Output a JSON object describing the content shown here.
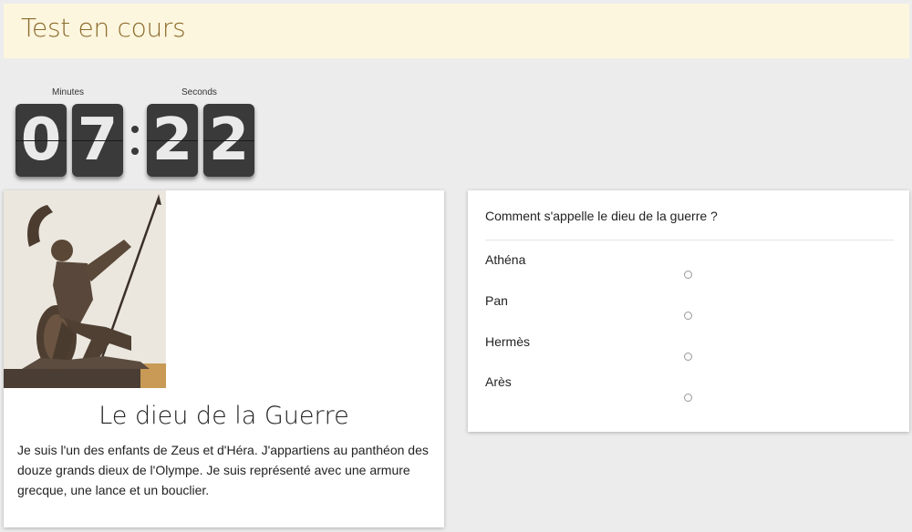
{
  "header": {
    "title": "Test en cours"
  },
  "timer": {
    "minutes_label": "Minutes",
    "seconds_label": "Seconds",
    "minutes_digits": [
      "0",
      "7"
    ],
    "seconds_digits": [
      "2",
      "2"
    ]
  },
  "lesson": {
    "image_icon": "spartan-warrior-statue",
    "title": "Le dieu de la Guerre",
    "text": "Je suis l'un des enfants de Zeus et d'Héra. J'appartiens au panthéon des douze grands dieux de l'Olympe. Je suis représenté avec une armure grecque, une lance et un bouclier."
  },
  "quiz": {
    "question": "Comment s'appelle le dieu de la guerre ?",
    "options": [
      "Athéna",
      "Pan",
      "Hermès",
      "Arès"
    ]
  },
  "colors": {
    "header_bg": "#fdf6df",
    "header_text": "#8b6b2c",
    "flip_digit_bg": "#3a3a3a",
    "page_bg": "#ececec"
  }
}
